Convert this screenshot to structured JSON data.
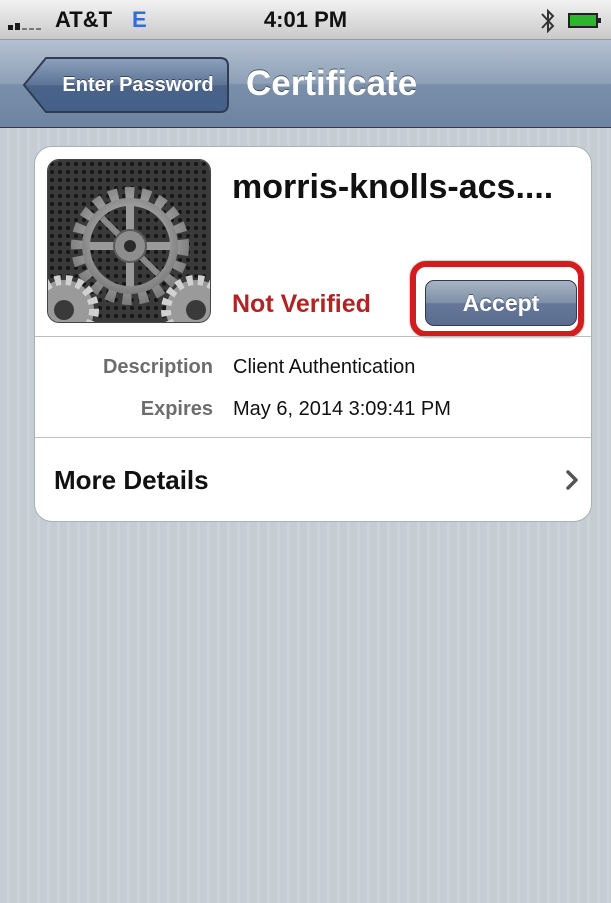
{
  "status_bar": {
    "carrier": "AT&T",
    "network": "E",
    "time": "4:01 PM",
    "icons": [
      "signal-icon",
      "bluetooth-icon",
      "battery-icon"
    ]
  },
  "nav_bar": {
    "back_label": "Enter Password",
    "title": "Certificate"
  },
  "certificate": {
    "icon": "settings-gears-icon",
    "name": "morris-knolls-acs....",
    "status": "Not Verified",
    "accept_label": "Accept",
    "details": [
      {
        "label": "Description",
        "value": "Client Authentication"
      },
      {
        "label": "Expires",
        "value": "May 6, 2014 3:09:41 PM"
      }
    ],
    "more_details_label": "More Details"
  },
  "colors": {
    "status_not_verified": "#b12424",
    "highlight_outline": "#d21d1d",
    "nav_bar": "#7a8fa9"
  }
}
